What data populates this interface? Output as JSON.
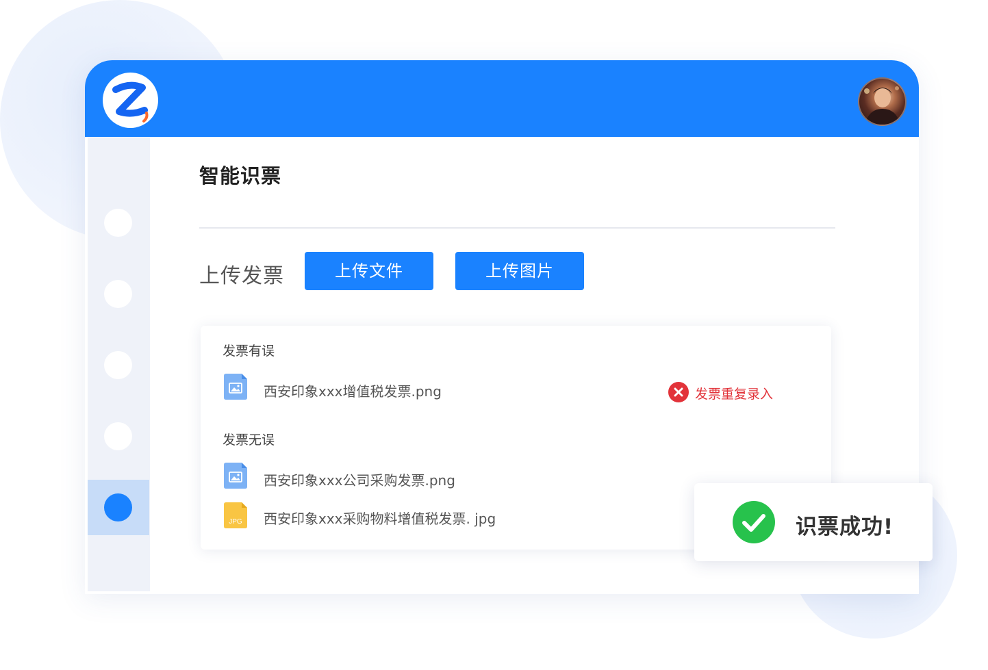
{
  "page": {
    "title": "智能识票",
    "upload_label": "上传发票",
    "buttons": {
      "upload_file": "上传文件",
      "upload_image": "上传图片"
    }
  },
  "results": {
    "error_section": {
      "title": "发票有误",
      "files": [
        {
          "name": "西安印象xxx增值税发票.png",
          "icon": "image-file-icon",
          "status": "发票重复录入"
        }
      ]
    },
    "ok_section": {
      "title": "发票无误",
      "files": [
        {
          "name": "西安印象xxx公司采购发票.png",
          "icon": "image-file-icon"
        },
        {
          "name": "西安印象xxx采购物料增值税发票. jpg",
          "icon": "jpg-file-icon",
          "badge": "JPG"
        }
      ]
    }
  },
  "toast": {
    "message": "识票成功!",
    "icon": "check-circle-icon"
  },
  "sidebar": {
    "items": 5,
    "active_index": 4
  },
  "colors": {
    "primary": "#1a82ff",
    "error": "#e2333a",
    "success": "#27c24c",
    "file_blue": "#7db2f5",
    "file_yellow": "#f9c543"
  }
}
